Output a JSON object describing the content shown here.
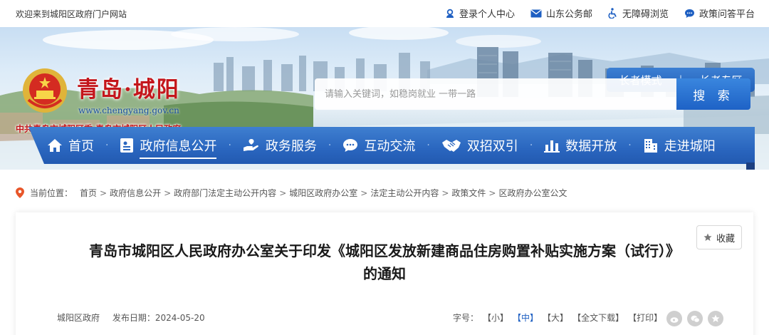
{
  "topbar": {
    "welcome": "欢迎来到城阳区政府门户网站",
    "links": [
      {
        "label": "登录个人中心",
        "icon": "user-icon"
      },
      {
        "label": "山东公务邮",
        "icon": "mail-icon"
      },
      {
        "label": "无障碍浏览",
        "icon": "accessibility-icon"
      },
      {
        "label": "政策问答平台",
        "icon": "chat-icon"
      }
    ]
  },
  "header": {
    "site_title": "青岛·城阳",
    "site_url": "www.chengyang.gov.cn",
    "site_subtitle": "中共青岛市城阳区委  青岛市城阳区人民政府",
    "elder_mode": "长者模式",
    "elder_zone": "长者专区",
    "search_placeholder": "请输入关键词，如稳岗就业 一带一路",
    "search_button": "搜 索"
  },
  "nav": {
    "items": [
      {
        "label": "首页",
        "icon": "home-icon"
      },
      {
        "label": "政府信息公开",
        "icon": "document-icon",
        "active": true
      },
      {
        "label": "政务服务",
        "icon": "service-hand-icon"
      },
      {
        "label": "互动交流",
        "icon": "chat-bubble-icon"
      },
      {
        "label": "双招双引",
        "icon": "handshake-icon"
      },
      {
        "label": "数据开放",
        "icon": "bar-chart-icon"
      },
      {
        "label": "走进城阳",
        "icon": "building-icon"
      }
    ]
  },
  "breadcrumb": {
    "lead": "当前位置：",
    "items": [
      "首页",
      "政府信息公开",
      "政府部门法定主动公开内容",
      "城阳区政府办公室",
      "法定主动公开内容",
      "政策文件",
      "区政府办公室公文"
    ]
  },
  "article": {
    "favorite": "收藏",
    "title_line1": "青岛市城阳区人民政府办公室关于印发《城阳区发放新建商品住房购置补贴实施方案（试行）》",
    "title_line2": "的通知",
    "source": "城阳区政府",
    "date_label": "发布日期：",
    "date": "2024-05-20",
    "font_label": "字号：",
    "size_small": "【小】",
    "size_medium": "【中】",
    "size_large": "【大】",
    "download": "【全文下载】",
    "print": "【打印】"
  },
  "colors": {
    "brand_red": "#c4161c",
    "nav_blue": "#2a66bf",
    "link_blue": "#1e5fc2"
  }
}
